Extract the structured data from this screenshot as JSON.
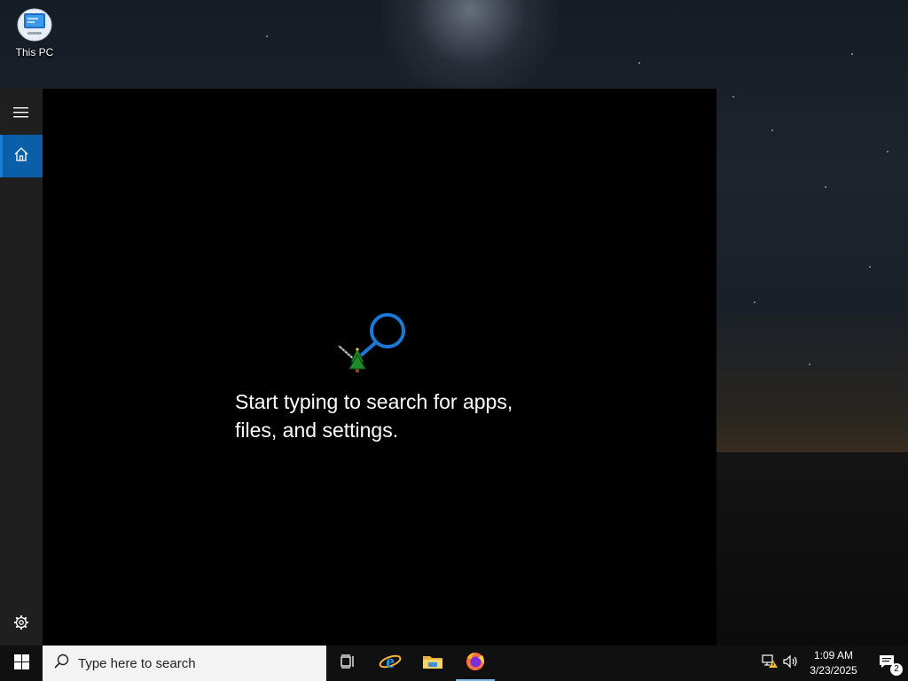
{
  "desktop": {
    "icons": [
      {
        "label": "This PC",
        "icon": "computer-icon"
      }
    ]
  },
  "search_panel": {
    "hint_line1": "Start typing to search for apps,",
    "hint_line2": "files, and settings.",
    "rail": {
      "menu_icon": "hamburger-icon",
      "home_icon": "home-icon",
      "settings_icon": "gear-icon"
    },
    "accent_color": "#0b5ea8"
  },
  "taskbar": {
    "start_icon": "windows-logo-icon",
    "search": {
      "placeholder": "Type here to search",
      "icon": "search-icon"
    },
    "apps": [
      {
        "name": "Task View",
        "icon": "task-view-icon"
      },
      {
        "name": "Internet Explorer",
        "icon": "internet-explorer-icon"
      },
      {
        "name": "File Explorer",
        "icon": "folder-icon"
      },
      {
        "name": "Firefox",
        "icon": "firefox-icon",
        "running": true
      }
    ],
    "tray": {
      "network_icon": "network-warning-icon",
      "volume_icon": "speaker-icon",
      "time": "1:09 AM",
      "date": "3/23/2025",
      "notifications_count": "2"
    }
  }
}
